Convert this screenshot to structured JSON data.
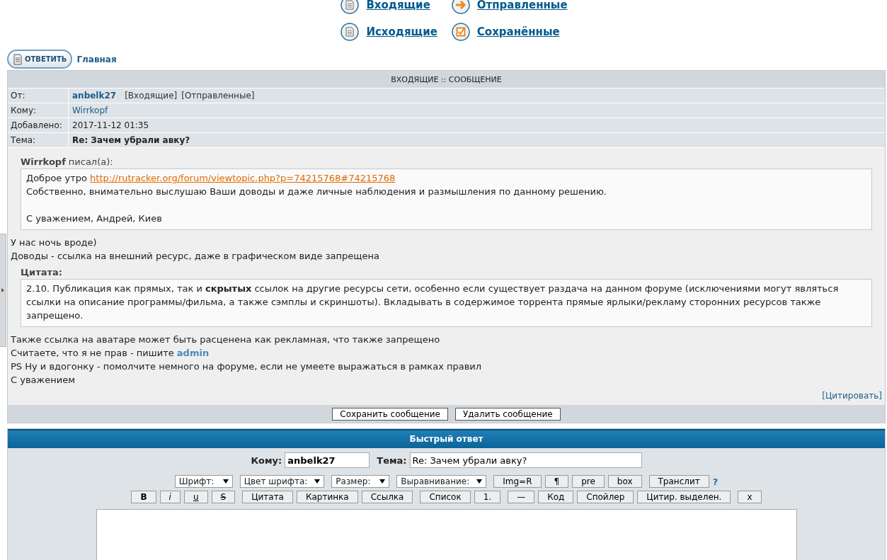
{
  "nav": [
    {
      "label": "Входящие",
      "kind": "doc"
    },
    {
      "label": "Отправленные",
      "kind": "arrow"
    },
    {
      "label": "Исходящие",
      "kind": "doc"
    },
    {
      "label": "Сохранённые",
      "kind": "check"
    }
  ],
  "reply_button": "ОТВЕТИТЬ",
  "home_link": "Главная",
  "message": {
    "title": "ВХОДЯЩИЕ :: СООБЩЕНИЕ",
    "fields": [
      {
        "label": "От:",
        "value": "anbelk27",
        "kind": "user",
        "links": [
          "[Входящие]",
          "[Отправленные]"
        ]
      },
      {
        "label": "Кому:",
        "value": "Wirrkopf",
        "kind": "link"
      },
      {
        "label": "Добавлено:",
        "value": "2017-11-12 01:35",
        "kind": "text"
      },
      {
        "label": "Тема:",
        "value": "Re: Зачем убрали авку?",
        "kind": "bold"
      }
    ],
    "body": [
      {
        "kind": "quote",
        "author": "Wirrkopf",
        "header": "писал(а):",
        "paragraphs": [
          [
            [
              {
                "kind": "plain",
                "text": "Доброе утро"
              },
              {
                "kind": "url",
                "text": "http://rutracker.org/forum/viewtopic.php?p=74215768#74215768"
              }
            ],
            [
              {
                "kind": "plain",
                "text": "Собственно, внимательно выслушаю Ваши доводы и даже личные наблюдения и размышления по данному решению."
              }
            ]
          ],
          [
            [
              {
                "kind": "plain",
                "text": "С уважением, Андрей, Киев"
              }
            ]
          ]
        ]
      },
      {
        "kind": "text",
        "paragraphs": [
          [
            [
              {
                "kind": "plain",
                "text": "У нас ночь вроде)"
              }
            ],
            [
              {
                "kind": "plain",
                "text": "Доводы - ссылка на внешний ресурс, даже в графическом виде запрещена"
              }
            ]
          ]
        ]
      },
      {
        "kind": "quote",
        "header": "Цитата:",
        "paragraphs": [
          [
            [
              {
                "kind": "plain",
                "text": "2.10. Публикация как прямых, так и **скрытых** ссылок на другие ресурсы сети, особенно если существует раздача на данном форуме (исключениями могут являться ссылки на описание программы/фильма, а также сэмплы и скриншоты). Вкладывать в содержимое торрента прямые ярлыки/рекламу сторонних ресурсов также запрещено."
              }
            ]
          ]
        ]
      },
      {
        "kind": "text",
        "paragraphs": [
          [
            [
              {
                "kind": "plain",
                "text": "Также ссылка на аватаре может быть расценена как рекламная, что также запрещено"
              }
            ],
            [
              {
                "kind": "plain",
                "text": "Считаете, что я не прав - пишите"
              },
              {
                "kind": "user",
                "text": "admin"
              }
            ],
            [
              {
                "kind": "plain",
                "text": "PS Ну и вдогонку - помолчите немного на форуме, если не умеете выражаться в рамках правил"
              }
            ],
            [
              {
                "kind": "plain",
                "text": "С уважением"
              }
            ]
          ]
        ]
      }
    ],
    "quote_link": "[Цитировать]",
    "buttons": [
      "Сохранить сообщение",
      "Удалить сообщение"
    ]
  },
  "quick_reply": {
    "title": "Быстрый ответ",
    "to_label": "Кому:",
    "to_value": "anbelk27",
    "subject_label": "Тема:",
    "subject_value": "Re: Зачем убрали авку?",
    "selects": [
      "Шрифт:",
      "Цвет шрифта:",
      "Размер:",
      "Выравнивание:"
    ],
    "row1": [
      [
        {
          "label": "Img=R",
          "kind": "plain"
        },
        {
          "label": "¶",
          "kind": "plain"
        },
        {
          "label": "pre",
          "kind": "plain"
        },
        {
          "label": "box",
          "kind": "plain"
        }
      ],
      [
        {
          "label": "Транслит",
          "kind": "plain"
        },
        {
          "label": "?",
          "kind": "help"
        }
      ]
    ],
    "row2": [
      [
        {
          "label": "B",
          "kind": "bold"
        },
        {
          "label": "i",
          "kind": "italic"
        },
        {
          "label": "u",
          "kind": "underline"
        },
        {
          "label": "S",
          "kind": "strike"
        }
      ],
      [
        {
          "label": "Цитата",
          "kind": "plain"
        },
        {
          "label": "Картинка",
          "kind": "plain"
        },
        {
          "label": "Ссылка",
          "kind": "plain"
        }
      ],
      [
        {
          "label": "Список",
          "kind": "plain"
        },
        {
          "label": "1.",
          "kind": "plain"
        }
      ],
      [
        {
          "label": "—",
          "kind": "plain"
        },
        {
          "label": "Код",
          "kind": "plain"
        },
        {
          "label": "Спойлер",
          "kind": "plain"
        },
        {
          "label": "Цитир. выделен.",
          "kind": "plain"
        }
      ],
      [
        {
          "label": "x",
          "kind": "plain"
        }
      ]
    ]
  }
}
